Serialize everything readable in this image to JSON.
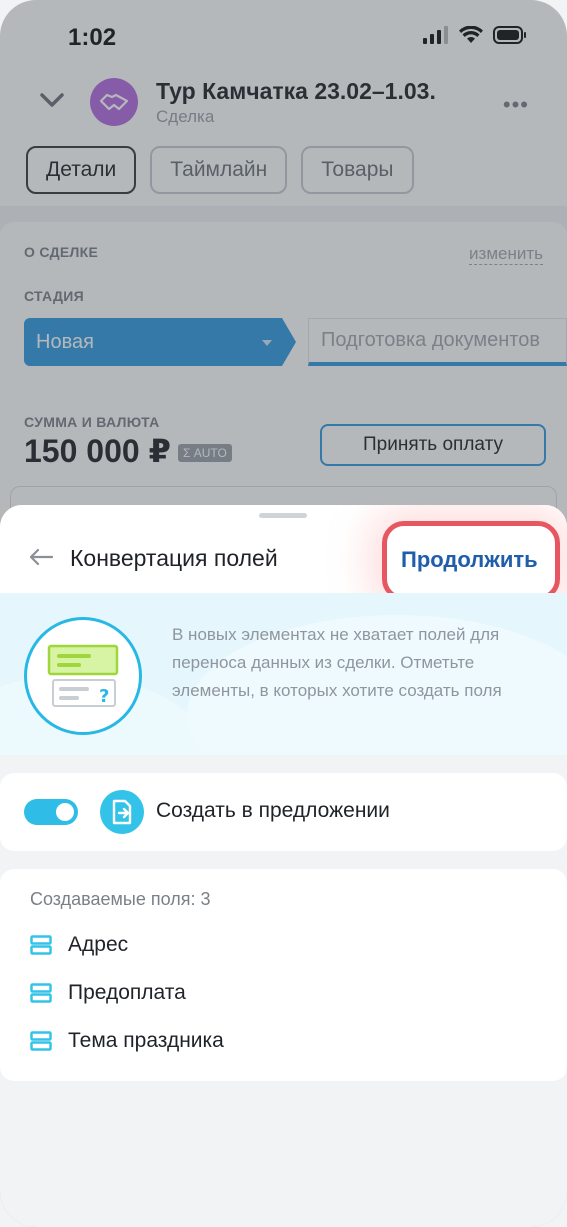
{
  "status_bar": {
    "time": "1:02"
  },
  "header": {
    "title": "Тур Камчатка 23.02–1.03.",
    "subtitle": "Сделка",
    "more": "•••"
  },
  "tabs": [
    {
      "label": "Детали",
      "active": true
    },
    {
      "label": "Таймлайн",
      "active": false
    },
    {
      "label": "Товары",
      "active": false
    }
  ],
  "deal_card": {
    "section_title": "О СДЕЛКЕ",
    "edit_link": "изменить",
    "stage_label": "СТАДИЯ",
    "stage_current": "Новая",
    "stage_next": "Подготовка документов",
    "sum_label": "СУММА И ВАЛЮТА",
    "sum_value": "150 000 ₽",
    "auto_badge": "Σ AUTO",
    "pay_button": "Принять оплату"
  },
  "sheet": {
    "title": "Конвертация полей",
    "continue_button": "Продолжить",
    "info_text": "В новых элементах не хватает полей для переноса данных из сделки. Отметьте элементы, в которых хотите создать поля",
    "toggle_label": "Создать в предложении",
    "toggle_on": true,
    "fields_count": "Создаваемые поля: 3",
    "fields": [
      {
        "label": "Адрес",
        "icon": "field-icon"
      },
      {
        "label": "Предоплата",
        "icon": "field-icon"
      },
      {
        "label": "Тема праздника",
        "icon": "field-icon"
      }
    ]
  },
  "colors": {
    "accent": "#2fbde8",
    "stage_blue": "#2f9ae0",
    "continue_text": "#1f5eab",
    "highlight_border": "#e65762"
  }
}
